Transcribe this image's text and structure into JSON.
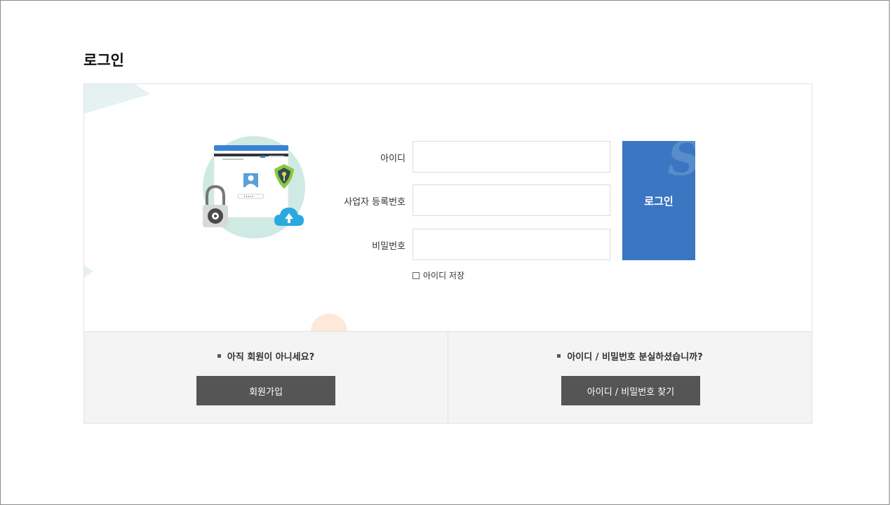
{
  "page": {
    "title": "로그인"
  },
  "form": {
    "id_label": "아이디",
    "id_value": "",
    "business_no_label": "사업자 등록번호",
    "business_no_value": "",
    "password_label": "비밀번호",
    "password_value": "",
    "remember_label": "아이디 저장",
    "remember_checked": false,
    "submit_label": "로그인"
  },
  "bottom": {
    "signup_prompt": "아직 회원이 아니세요?",
    "signup_button": "회원가입",
    "find_prompt": "아이디 / 비밀번호 분실하셨습니까?",
    "find_button": "아이디 / 비밀번호 찾기"
  },
  "illustration": {
    "masked_password": "•••••",
    "icons": [
      "padlock-icon",
      "user-avatar-icon",
      "shield-key-icon",
      "cloud-upload-icon",
      "browser-window-icon"
    ]
  },
  "colors": {
    "primary_button": "#3a76c2",
    "dark_button": "#555555",
    "bottom_bar": "#f4f4f4",
    "illustration_circle": "#cfe9e3"
  }
}
